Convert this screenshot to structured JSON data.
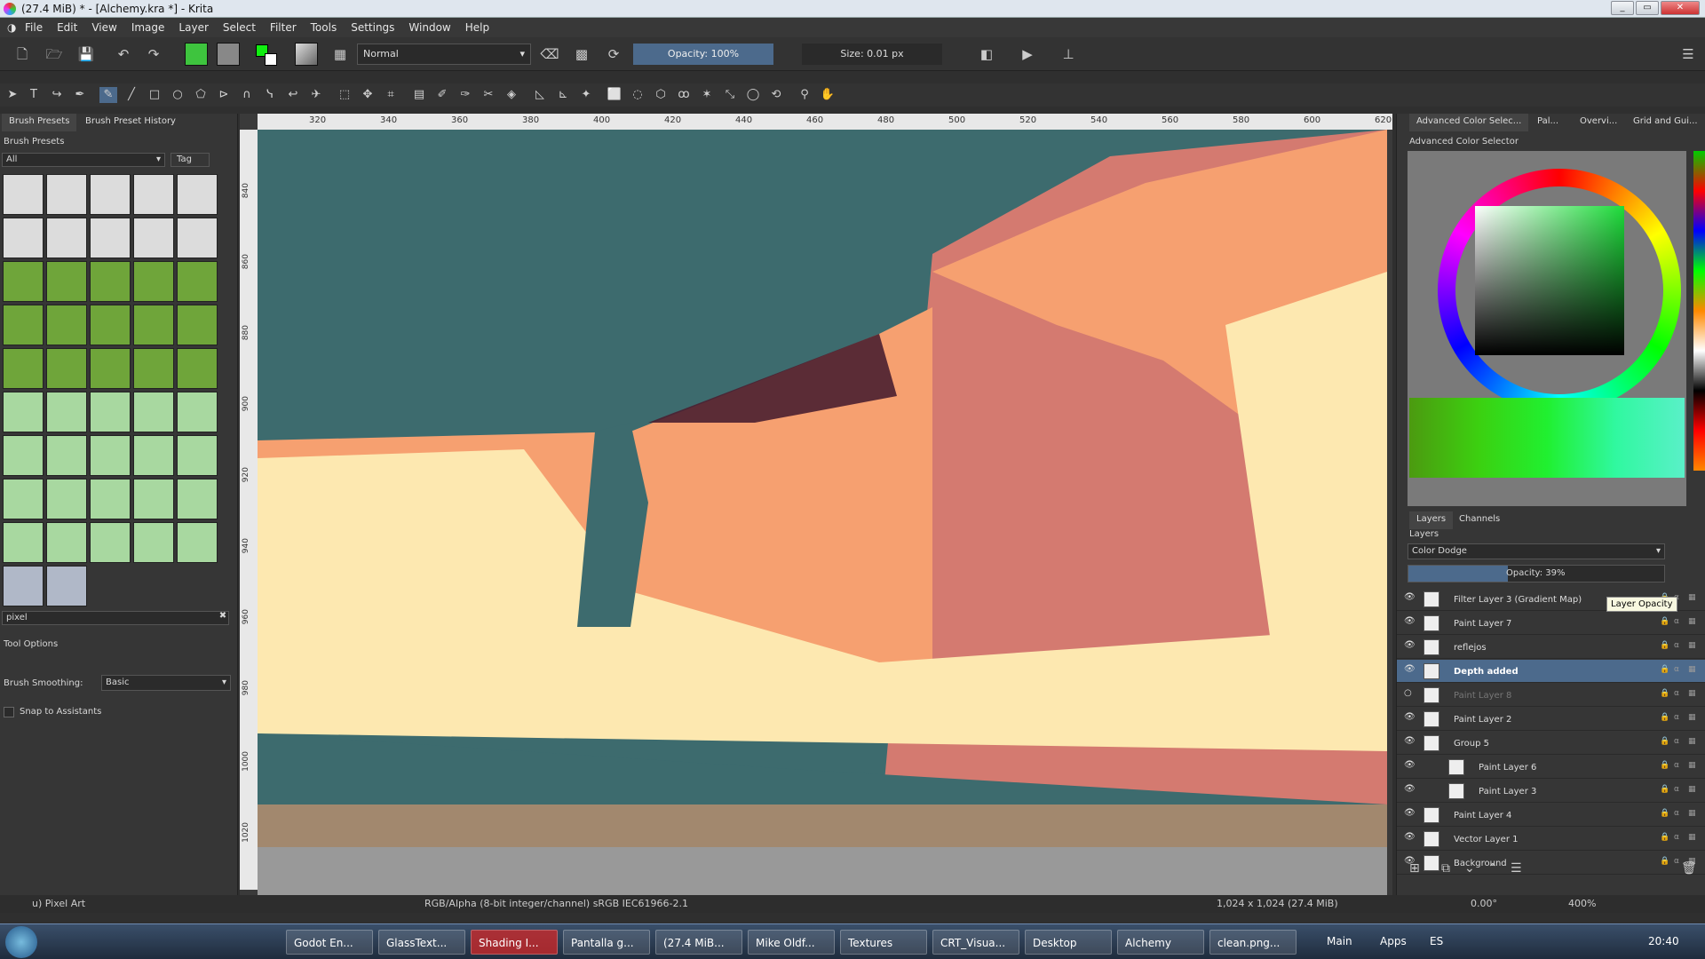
{
  "window": {
    "title": "(27.4 MiB)  * - [Alchemy.kra *] - Krita"
  },
  "menu": [
    "File",
    "Edit",
    "View",
    "Image",
    "Layer",
    "Select",
    "Filter",
    "Tools",
    "Settings",
    "Window",
    "Help"
  ],
  "toolbar": {
    "blend_mode": "Normal",
    "opacity": "Opacity: 100%",
    "size": "Size: 0.01 px"
  },
  "left": {
    "tabs": [
      "Brush Presets",
      "Brush Preset History"
    ],
    "presets_title": "Brush Presets",
    "filter_value": "All",
    "tag_label": "Tag",
    "search_value": "pixel",
    "tool_options_title": "Tool Options",
    "smoothing_label": "Brush Smoothing:",
    "smoothing_value": "Basic",
    "snap_label": "Snap to Assistants"
  },
  "ruler": {
    "top": [
      "320",
      "340",
      "360",
      "380",
      "400",
      "420",
      "440",
      "460",
      "480",
      "500",
      "520",
      "540",
      "560",
      "580",
      "600",
      "620"
    ],
    "left": [
      "840",
      "860",
      "880",
      "900",
      "920",
      "940",
      "960",
      "980",
      "1000",
      "1020"
    ]
  },
  "right": {
    "tabs": [
      "Advanced Color Selec...",
      "Pal...",
      "Overvi...",
      "Grid and Gui..."
    ],
    "selector_title": "Advanced Color Selector",
    "bottom_tabs": [
      "Layers",
      "Channels"
    ],
    "layers_title": "Layers",
    "blend_mode": "Color Dodge",
    "opacity": "Opacity:  39%",
    "tooltip": "Layer Opacity",
    "layers": [
      {
        "name": "Filter Layer 3 (Gradient Map)",
        "selected": false,
        "visible": true,
        "indent": false,
        "dim": false
      },
      {
        "name": "Paint Layer 7",
        "selected": false,
        "visible": true,
        "indent": false,
        "dim": false
      },
      {
        "name": "reflejos",
        "selected": false,
        "visible": true,
        "indent": false,
        "dim": false
      },
      {
        "name": "Depth added",
        "selected": true,
        "visible": true,
        "indent": false,
        "dim": false
      },
      {
        "name": "Paint Layer 8",
        "selected": false,
        "visible": false,
        "indent": false,
        "dim": true
      },
      {
        "name": "Paint Layer 2",
        "selected": false,
        "visible": true,
        "indent": false,
        "dim": false
      },
      {
        "name": "Group 5",
        "selected": false,
        "visible": true,
        "indent": false,
        "dim": false
      },
      {
        "name": "Paint Layer 6",
        "selected": false,
        "visible": true,
        "indent": true,
        "dim": false
      },
      {
        "name": "Paint Layer 3",
        "selected": false,
        "visible": true,
        "indent": true,
        "dim": false
      },
      {
        "name": "Paint Layer 4",
        "selected": false,
        "visible": true,
        "indent": false,
        "dim": false
      },
      {
        "name": "Vector Layer 1",
        "selected": false,
        "visible": true,
        "indent": false,
        "dim": false
      },
      {
        "name": "Background",
        "selected": false,
        "visible": true,
        "indent": false,
        "dim": false
      }
    ]
  },
  "status": {
    "tool": "u) Pixel Art",
    "colorspace": "RGB/Alpha (8-bit integer/channel)  sRGB IEC61966-2.1",
    "dims": "1,024 x 1,024 (27.4 MiB)",
    "rotation": "0.00°",
    "zoom": "400%"
  },
  "taskbar": {
    "items": [
      "Godot En...",
      "GlassText...",
      "Shading I...",
      "Pantalla g...",
      "(27.4 MiB...",
      "Mike Oldf...",
      "Textures",
      "CRT_Visua...",
      "Desktop",
      "Alchemy",
      "clean.png..."
    ],
    "right": [
      "Main",
      "Apps",
      "ES"
    ],
    "clock": "20:40"
  },
  "colors": {
    "canvas_teal": "#3d6b6e",
    "canvas_peach": "#f6a070",
    "canvas_cream": "#fde8b0",
    "canvas_rose": "#d47a70",
    "selection": "#4c6a8c"
  }
}
